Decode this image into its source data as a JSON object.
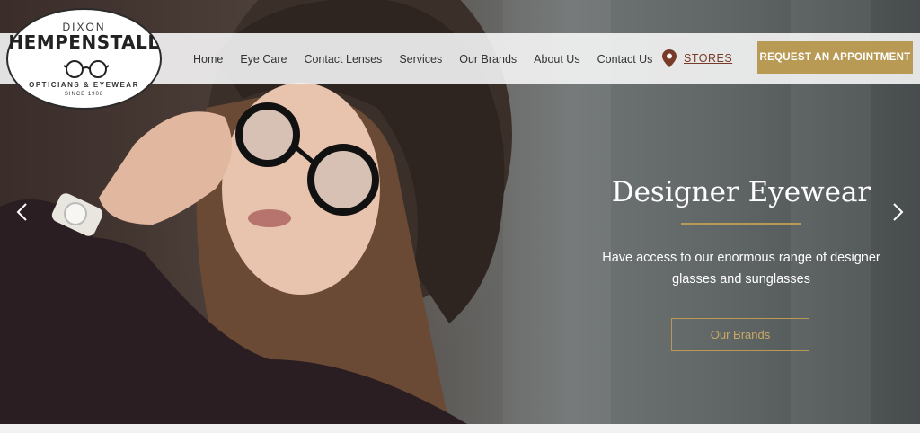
{
  "logo": {
    "top_text": "DIXON",
    "main_text": "HEMPENSTALL",
    "sub_text": "OPTICIANS & EYEWEAR",
    "since_text": "SINCE 1908"
  },
  "nav": {
    "items": [
      {
        "label": "Home"
      },
      {
        "label": "Eye Care"
      },
      {
        "label": "Contact Lenses"
      },
      {
        "label": "Services"
      },
      {
        "label": "Our Brands"
      },
      {
        "label": "About Us"
      },
      {
        "label": "Contact Us"
      }
    ],
    "stores_label": "STORES",
    "stores_icon": "map-pin-icon",
    "appointment_label": "REQUEST AN APPOINTMENT"
  },
  "hero": {
    "heading": "Designer Eyewear",
    "subtext": "Have access to our enormous range of designer glasses and sunglasses",
    "button_label": "Our Brands",
    "prev_icon": "chevron-left-icon",
    "next_icon": "chevron-right-icon"
  },
  "colors": {
    "accent": "#b89a55",
    "stores_link": "#7a3a2a",
    "nav_bg": "#f5f5f5"
  }
}
